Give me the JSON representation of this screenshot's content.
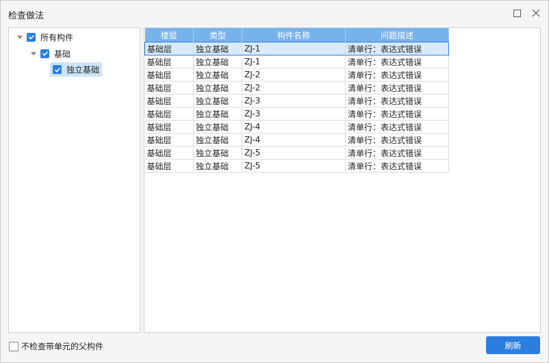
{
  "window": {
    "title": "检查做法"
  },
  "tree": {
    "items": [
      {
        "label": "所有构件",
        "checked": true,
        "expanded": true
      },
      {
        "label": "基础",
        "checked": true,
        "expanded": true
      },
      {
        "label": "独立基础",
        "checked": true,
        "selected": true
      }
    ]
  },
  "table": {
    "columns": [
      "楼层",
      "类型",
      "构件名称",
      "问题描述"
    ],
    "rows": [
      [
        "基础层",
        "独立基础",
        "ZJ-1",
        "清单行：表达式错误"
      ],
      [
        "基础层",
        "独立基础",
        "ZJ-1",
        "清单行：表达式错误"
      ],
      [
        "基础层",
        "独立基础",
        "ZJ-2",
        "清单行：表达式错误"
      ],
      [
        "基础层",
        "独立基础",
        "ZJ-2",
        "清单行：表达式错误"
      ],
      [
        "基础层",
        "独立基础",
        "ZJ-3",
        "清单行：表达式错误"
      ],
      [
        "基础层",
        "独立基础",
        "ZJ-3",
        "清单行：表达式错误"
      ],
      [
        "基础层",
        "独立基础",
        "ZJ-4",
        "清单行：表达式错误"
      ],
      [
        "基础层",
        "独立基础",
        "ZJ-4",
        "清单行：表达式错误"
      ],
      [
        "基础层",
        "独立基础",
        "ZJ-5",
        "清单行：表达式错误"
      ],
      [
        "基础层",
        "独立基础",
        "ZJ-5",
        "清单行：表达式错误"
      ]
    ]
  },
  "footer": {
    "checkbox_label": "不检查带单元的父构件",
    "checkbox_checked": false,
    "refresh_label": "刷新"
  },
  "colors": {
    "accent": "#2b7de0",
    "header_bg": "#78b2ea",
    "selection_bg": "#dbeaf8"
  }
}
